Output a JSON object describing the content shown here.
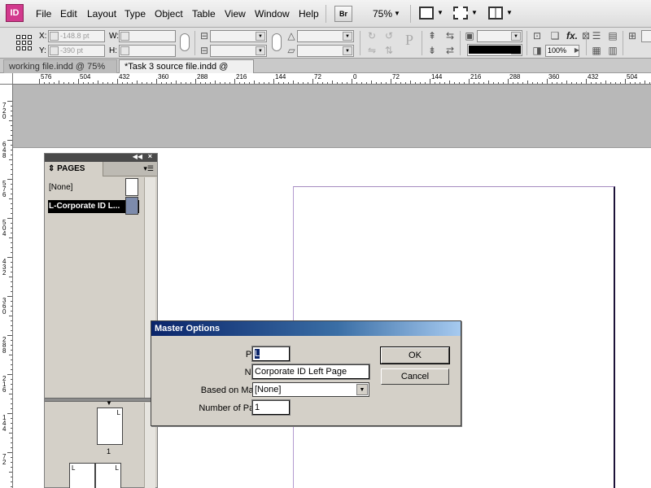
{
  "app": {
    "logo": "ID"
  },
  "menu": [
    "File",
    "Edit",
    "Layout",
    "Type",
    "Object",
    "Table",
    "View",
    "Window",
    "Help"
  ],
  "menubar": {
    "bridge_label": "Br",
    "zoom": "75%"
  },
  "control_panel": {
    "x_label": "X:",
    "x_value": "-148.8 pt",
    "y_label": "Y:",
    "y_value": "-390 pt",
    "w_label": "W:",
    "h_label": "H:",
    "opacity": "100%",
    "fx_label": "fx."
  },
  "tabs": [
    {
      "label": "working file.indd @ 75%",
      "active": false
    },
    {
      "label": "*Task 3 source file.indd @ 75%",
      "active": true
    }
  ],
  "ruler_h_labels": [
    "576",
    "504",
    "432",
    "360",
    "288",
    "216",
    "144",
    "72",
    "0",
    "72",
    "144",
    "216",
    "288",
    "360",
    "432",
    "504"
  ],
  "ruler_v_labels": [
    "720",
    "648",
    "576",
    "504",
    "432",
    "360",
    "288",
    "216",
    "144",
    "72"
  ],
  "pages_panel": {
    "title": "PAGES",
    "masters": [
      {
        "label": "[None]",
        "selected": false
      },
      {
        "label": "L-Corporate ID L...",
        "selected": true
      }
    ],
    "page_thumb_label": "L",
    "page_number": "1"
  },
  "dialog": {
    "title": "Master Options",
    "prefix_label": "Prefix:",
    "prefix_value": "L",
    "name_label": "Name:",
    "name_value": "Corporate ID Left Page",
    "based_label": "Based on Master:",
    "based_value": "[None]",
    "pages_label": "Number of Pages:",
    "pages_value": "1",
    "ok_label": "OK",
    "cancel_label": "Cancel"
  }
}
